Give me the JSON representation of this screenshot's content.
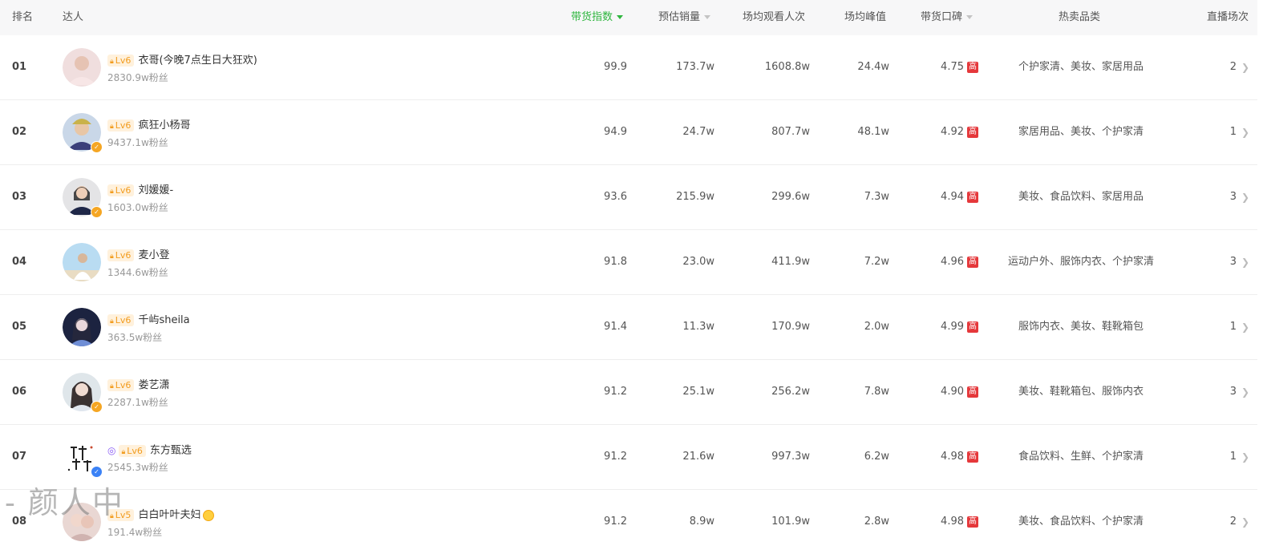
{
  "header": {
    "rank": "排名",
    "influencer": "达人",
    "index": "带货指数",
    "sales": "预估销量",
    "views": "场均观看人次",
    "peak": "场均峰值",
    "reputation": "带货口碑",
    "categories": "热卖品类",
    "live_count": "直播场次"
  },
  "rows": [
    {
      "rank": "01",
      "name": "衣哥(今晚7点生日大狂欢)",
      "level": "Lv6",
      "fans": "2830.9w粉丝",
      "index": "99.9",
      "sales": "173.7w",
      "views": "1608.8w",
      "peak": "24.4w",
      "rep": "4.75",
      "rep_tag": "高",
      "categories": "个护家清、美妆、家居用品",
      "live": "2",
      "verified": false
    },
    {
      "rank": "02",
      "name": "疯狂小杨哥",
      "level": "Lv6",
      "fans": "9437.1w粉丝",
      "index": "94.9",
      "sales": "24.7w",
      "views": "807.7w",
      "peak": "48.1w",
      "rep": "4.92",
      "rep_tag": "高",
      "categories": "家居用品、美妆、个护家清",
      "live": "1",
      "verified": true
    },
    {
      "rank": "03",
      "name": "刘媛媛-",
      "level": "Lv6",
      "fans": "1603.0w粉丝",
      "index": "93.6",
      "sales": "215.9w",
      "views": "299.6w",
      "peak": "7.3w",
      "rep": "4.94",
      "rep_tag": "高",
      "categories": "美妆、食品饮料、家居用品",
      "live": "3",
      "verified": true
    },
    {
      "rank": "04",
      "name": "麦小登",
      "level": "Lv6",
      "fans": "1344.6w粉丝",
      "index": "91.8",
      "sales": "23.0w",
      "views": "411.9w",
      "peak": "7.2w",
      "rep": "4.96",
      "rep_tag": "高",
      "categories": "运动户外、服饰内衣、个护家清",
      "live": "3",
      "verified": false
    },
    {
      "rank": "05",
      "name": "千屿sheila",
      "level": "Lv6",
      "fans": "363.5w粉丝",
      "index": "91.4",
      "sales": "11.3w",
      "views": "170.9w",
      "peak": "2.0w",
      "rep": "4.99",
      "rep_tag": "高",
      "categories": "服饰内衣、美妆、鞋靴箱包",
      "live": "1",
      "verified": false
    },
    {
      "rank": "06",
      "name": "娄艺潇",
      "level": "Lv6",
      "fans": "2287.1w粉丝",
      "index": "91.2",
      "sales": "25.1w",
      "views": "256.2w",
      "peak": "7.8w",
      "rep": "4.90",
      "rep_tag": "高",
      "categories": "美妆、鞋靴箱包、服饰内衣",
      "live": "3",
      "verified": true
    },
    {
      "rank": "07",
      "name": "东方甄选",
      "level": "Lv6",
      "fans": "2545.3w粉丝",
      "index": "91.2",
      "sales": "21.6w",
      "views": "997.3w",
      "peak": "6.2w",
      "rep": "4.98",
      "rep_tag": "高",
      "categories": "食品饮料、生鲜、个护家清",
      "live": "1",
      "verified": true
    },
    {
      "rank": "08",
      "name": "白白叶叶夫妇",
      "level": "Lv5",
      "fans": "191.4w粉丝",
      "index": "91.2",
      "sales": "8.9w",
      "views": "101.9w",
      "peak": "2.8w",
      "rep": "4.98",
      "rep_tag": "高",
      "categories": "美妆、食品饮料、个护家清",
      "live": "2",
      "verified": false
    }
  ],
  "watermark": "- 颜人中",
  "colors": {
    "accent": "#2fb63f",
    "level_bg": "#fff1dc",
    "level_fg": "#f29c1f",
    "high_badge": "#e5383b"
  }
}
